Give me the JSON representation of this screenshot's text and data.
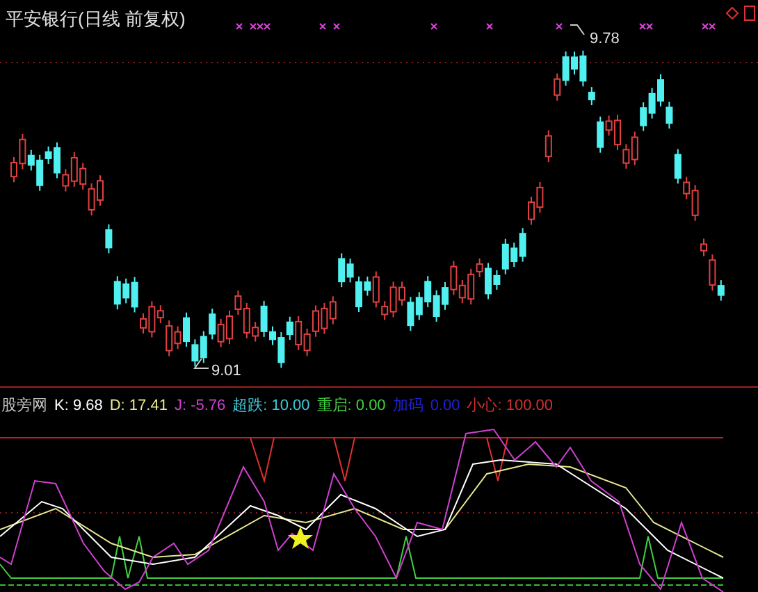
{
  "price_panel": {
    "title": "平安银行(日线 前复权)",
    "high_label": "9.78",
    "low_label": "9.01"
  },
  "indicator_panel": {
    "legend": [
      {
        "text": "股旁网",
        "color": "#c0c0c0"
      },
      {
        "text": "K: 9.68",
        "color": "#ffffff"
      },
      {
        "text": "D: 17.41",
        "color": "#e8e890"
      },
      {
        "text": "J: -5.76",
        "color": "#d040d0"
      },
      {
        "text": "超跌: 10.00",
        "color": "#40c8d8"
      },
      {
        "text": "重启: 0.00",
        "color": "#40d040"
      },
      {
        "text": "加码",
        "color": "#2020d0"
      },
      {
        "text": "0.00",
        "color": "#2020d0"
      },
      {
        "text": "小心: 100.00",
        "color": "#d03030"
      }
    ]
  }
}
